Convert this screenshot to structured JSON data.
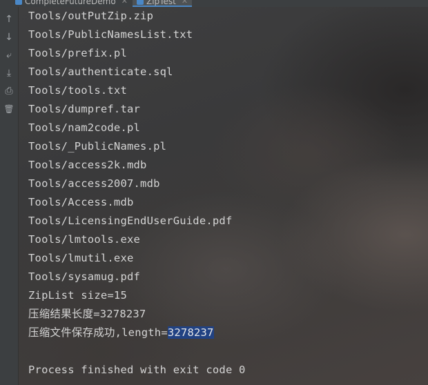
{
  "tabs": [
    {
      "label": "CompleteFutureDemo",
      "active": false
    },
    {
      "label": "ZipTest",
      "active": true
    }
  ],
  "toolbar": [
    {
      "icon": "arrow-up-icon",
      "glyph": "↑"
    },
    {
      "icon": "arrow-down-icon",
      "glyph": "↓"
    },
    {
      "icon": "soft-wrap-icon",
      "glyph": "⤶"
    },
    {
      "icon": "scroll-to-end-icon",
      "glyph": "⤓"
    },
    {
      "icon": "print-icon",
      "glyph": "⎙"
    },
    {
      "icon": "trash-icon",
      "glyph": "🗑"
    }
  ],
  "console": {
    "files": [
      "Tools/outPutZip.zip",
      "Tools/PublicNamesList.txt",
      "Tools/prefix.pl",
      "Tools/authenticate.sql",
      "Tools/tools.txt",
      "Tools/dumpref.tar",
      "Tools/nam2code.pl",
      "Tools/_PublicNames.pl",
      "Tools/access2k.mdb",
      "Tools/access2007.mdb",
      "Tools/Access.mdb",
      "Tools/LicensingEndUserGuide.pdf",
      "Tools/lmtools.exe",
      "Tools/lmutil.exe",
      "Tools/sysamug.pdf"
    ],
    "zip_list_size": "ZipList size=15",
    "compress_result_length": "压缩结果长度=3278237",
    "save_success_prefix": "压缩文件保存成功,length=",
    "save_success_value": "3278237",
    "exit_message": "Process finished with exit code 0"
  }
}
